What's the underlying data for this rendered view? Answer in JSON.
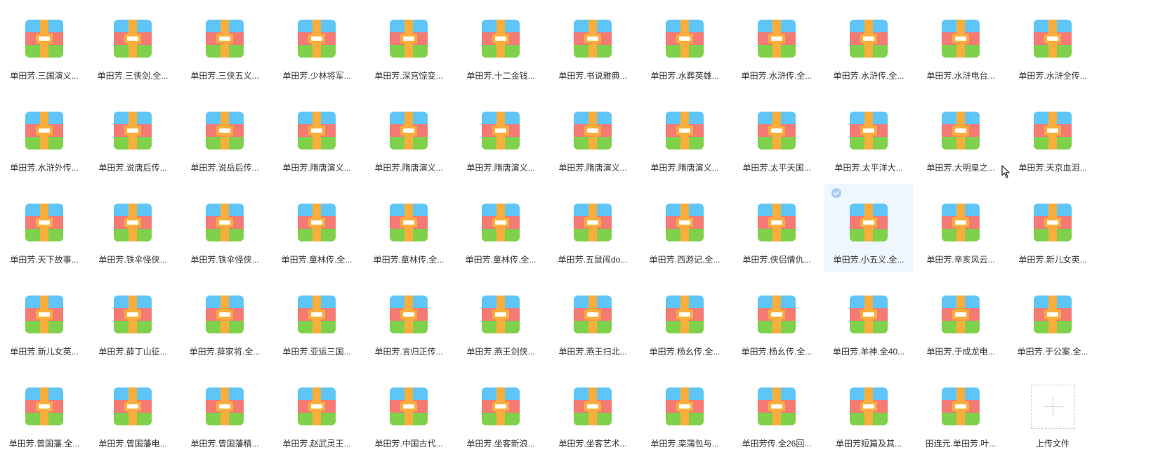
{
  "files": [
    "单田芳.三国演义...",
    "单田芳.三侠剑.全...",
    "单田芳.三侠五义...",
    "单田芳.少林将军...",
    "单田芳.深宫惊变...",
    "单田芳.十二金钱...",
    "单田芳.书说雅典...",
    "单田芳.水葬英雄...",
    "单田芳.水浒传.全...",
    "单田芳.水浒传.全...",
    "单田芳.水浒电台...",
    "单田芳.水浒全传...",
    "单田芳.水浒外传...",
    "单田芳.说唐后传...",
    "单田芳.说岳后传...",
    "单田芳.隋唐演义...",
    "单田芳.隋唐演义...",
    "单田芳.隋唐演义...",
    "单田芳.隋唐演义...",
    "单田芳.隋唐演义...",
    "单田芳.太平天国...",
    "单田芳.太平洋大...",
    "单田芳.大明皇之...",
    "单田芳.天京血泪...",
    "单田芳.天下故事...",
    "单田芳.铁伞怪侠...",
    "单田芳.铁伞怪侠...",
    "单田芳.童林传.全...",
    "单田芳.童林传.全...",
    "单田芳.童林传.全...",
    "单田芳.五鼠闹do...",
    "单田芳.西游记.全...",
    "单田芳.侠侣情仇...",
    "单田芳.小五义.全...",
    "单田芳.辛亥风云...",
    "单田芳.新儿女英...",
    "单田芳.新儿女英...",
    "单田芳.薛丁山征...",
    "单田芳.薛家将.全...",
    "单田芳.亚运三国...",
    "单田芳.言归正传...",
    "单田芳.燕王剑侠...",
    "单田芳.燕王扫北...",
    "单田芳.杨幺传.全...",
    "单田芳.杨幺传.全...",
    "单田芳.羊神.全40...",
    "单田芳.于成龙电...",
    "单田芳.于公案.全...",
    "单田芳.曾国藩.全...",
    "单田芳.曾国藩电...",
    "单田芳.曾国藩精...",
    "单田芳.赵武灵王...",
    "单田芳.中国古代...",
    "单田芳.坐客新浪...",
    "单田芳.坐客艺术...",
    "单田芳.栾蒲包与...",
    "单田芳传.全26回...",
    "单田芳短篇及其...",
    "田连元.单田芳.叶..."
  ],
  "selected_index": 33,
  "upload": {
    "label": "上传文件"
  },
  "icon": {
    "name": "archive-icon",
    "colors": {
      "top": "#5ec5f6",
      "middle": "#f47a74",
      "bottom": "#7fd04a",
      "strap": "#f9ae3c",
      "buckle": "#ffffff"
    }
  },
  "selection": {
    "background": "#eef6fe",
    "check_color": "#a9cdf3"
  }
}
